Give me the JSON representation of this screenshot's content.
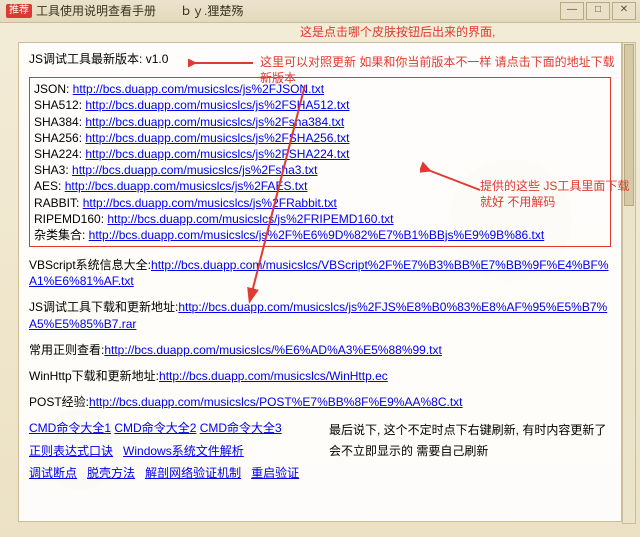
{
  "window": {
    "badge": "推荐",
    "title": "工具使用说明查看手册　　ｂｙ.狸楚殇",
    "minimize": "—",
    "maximize": "□",
    "close": "✕"
  },
  "annotations": {
    "top": "这是点击哪个皮肤按钮后出来的界面,",
    "below_version": "这里可以对照更新 如果和你当前版本不一样 请点击下面的地址下载新版本",
    "right_side": "提供的这些 JS工具里面下载就好 不用解码"
  },
  "version_line_label": "JS调试工具最新版本:",
  "version_line_value": "v1.0",
  "url_list": [
    {
      "label": "JSON:",
      "url": "http://bcs.duapp.com/musicslcs/js%2FJSON.txt"
    },
    {
      "label": "SHA512:",
      "url": "http://bcs.duapp.com/musicslcs/js%2FSHA512.txt"
    },
    {
      "label": "SHA384:",
      "url": "http://bcs.duapp.com/musicslcs/js%2Fsha384.txt"
    },
    {
      "label": "SHA256:",
      "url": "http://bcs.duapp.com/musicslcs/js%2FSHA256.txt"
    },
    {
      "label": "SHA224:",
      "url": "http://bcs.duapp.com/musicslcs/js%2FSHA224.txt"
    },
    {
      "label": "SHA3:",
      "url": "http://bcs.duapp.com/musicslcs/js%2Fsha3.txt"
    },
    {
      "label": "AES:",
      "url": "http://bcs.duapp.com/musicslcs/js%2FAES.txt"
    },
    {
      "label": "RABBIT:",
      "url": "http://bcs.duapp.com/musicslcs/js%2FRabbit.txt"
    },
    {
      "label": "RIPEMD160:",
      "url": "http://bcs.duapp.com/musicslcs/js%2FRIPEMD160.txt"
    },
    {
      "label": "杂类集合:",
      "url": "http://bcs.duapp.com/musicslcs/js%2F%E6%9D%82%E7%B1%BBjs%E9%9B%86.txt"
    }
  ],
  "sections": [
    {
      "label": "VBScript系统信息大全:",
      "url": "http://bcs.duapp.com/musicslcs/VBScript%2F%E7%B3%BB%E7%BB%9F%E4%BF%A1%E6%81%AF.txt"
    },
    {
      "label": "JS调试工具下载和更新地址:",
      "url": "http://bcs.duapp.com/musicslcs/js%2FJS%E8%B0%83%E8%AF%95%E5%B7%A5%E5%85%B7.rar"
    },
    {
      "label": "常用正则查看:",
      "url": "http://bcs.duapp.com/musicslcs/%E6%AD%A3%E5%88%99.txt"
    },
    {
      "label": "WinHttp下载和更新地址:",
      "url": "http://bcs.duapp.com/musicslcs/WinHttp.ec"
    },
    {
      "label": "POST经验:",
      "url": "http://bcs.duapp.com/musicslcs/POST%E7%BB%8F%E9%AA%8C.txt"
    }
  ],
  "cmds": {
    "r1": {
      "a": "CMD命令大全1",
      "b": "CMD命令大全2",
      "c": "CMD命令大全3"
    },
    "r2": {
      "a": "正则表达式口诀",
      "b": "Windows系统文件解析"
    },
    "r3": {
      "a": "调试断点",
      "b": "脱壳方法",
      "c": "解剖网络验证机制",
      "d": "重启验证"
    }
  },
  "end_note": "最后说下, 这个不定时点下右键刷新, 有时内容更新了会不立即显示的 需要自己刷新"
}
